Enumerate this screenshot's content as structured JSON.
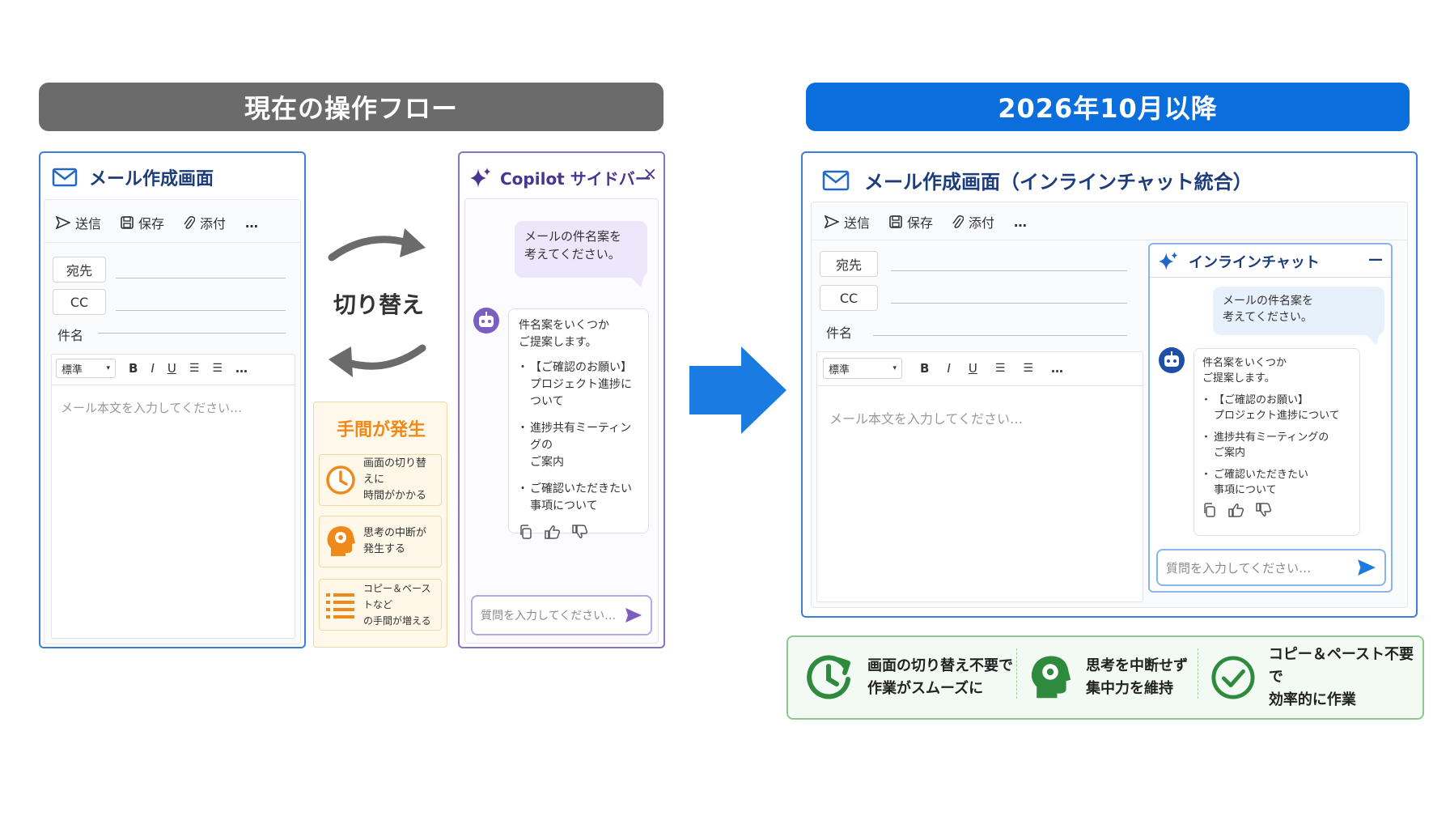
{
  "left_banner": "現在の操作フロー",
  "right_banner": "2026年10月以降",
  "colors": {
    "gray_banner": "#6b6b6b",
    "blue_banner": "#0a6fdc",
    "panel_border_blue": "#3d7fd6",
    "purple": "#7a5fc0",
    "orange": "#ef8a1a",
    "green": "#2e8a3d",
    "arrow_blue": "#1a7be0"
  },
  "left_compose": {
    "title": "メール作成画面",
    "toolbar": {
      "send": "送信",
      "save": "保存",
      "attach": "添付",
      "more": "…"
    },
    "to_label": "宛先",
    "cc_label": "CC",
    "subject_label": "件名",
    "format": {
      "style": "標準",
      "bold": "B",
      "italic": "I",
      "underline": "U",
      "more": "…"
    },
    "body_placeholder": "メール本文を入力してください…"
  },
  "middle": {
    "switch_label": "切り替え",
    "warn_title": "手間が発生",
    "warn_items": [
      {
        "icon": "clock-icon",
        "line1": "画面の切り替えに",
        "line2": "時間がかかる"
      },
      {
        "icon": "brain-head-icon",
        "line1": "思考の中断が",
        "line2": "発生する"
      },
      {
        "icon": "list-icon",
        "line1": "コピー＆ペーストなど",
        "line2": "の手間が増える"
      }
    ]
  },
  "copilot": {
    "title": "Copilot サイドバー",
    "close": "×",
    "user_msg_line1": "メールの件名案を",
    "user_msg_line2": "考えてください。",
    "bot_intro_line1": "件名案をいくつか",
    "bot_intro_line2": "ご提案します。",
    "suggestions": [
      {
        "line1": "【ご確認のお願い】",
        "line2": "プロジェクト進捗について"
      },
      {
        "line1": "進捗共有ミーティングの",
        "line2": "ご案内"
      },
      {
        "line1": "ご確認いただきたい",
        "line2": "事項について"
      }
    ],
    "input_placeholder": "質問を入力してください…"
  },
  "right_compose": {
    "title": "メール作成画面（インラインチャット統合）",
    "toolbar": {
      "send": "送信",
      "save": "保存",
      "attach": "添付",
      "more": "…"
    },
    "to_label": "宛先",
    "cc_label": "CC",
    "subject_label": "件名",
    "format": {
      "style": "標準",
      "bold": "B",
      "italic": "I",
      "underline": "U",
      "more": "…"
    },
    "body_placeholder": "メール本文を入力してください…"
  },
  "inline_chat": {
    "title": "インラインチャット",
    "minimize": "—",
    "user_msg_line1": "メールの件名案を",
    "user_msg_line2": "考えてください。",
    "bot_intro_line1": "件名案をいくつか",
    "bot_intro_line2": "ご提案します。",
    "suggestions": [
      {
        "line1": "【ご確認のお願い】",
        "line2": "プロジェクト進捗について"
      },
      {
        "line1": "進捗共有ミーティングの",
        "line2": "ご案内"
      },
      {
        "line1": "ご確認いただきたい",
        "line2": "事項について"
      }
    ],
    "input_placeholder": "質問を入力してください…"
  },
  "benefits": [
    {
      "icon": "clock-refresh-icon",
      "line1": "画面の切り替え不要で",
      "line2": "作業がスムーズに"
    },
    {
      "icon": "brain-head-icon",
      "line1": "思考を中断せず",
      "line2": "集中力を維持"
    },
    {
      "icon": "check-circle-icon",
      "line1": "コピー＆ペースト不要で",
      "line2": "効率的に作業"
    }
  ]
}
